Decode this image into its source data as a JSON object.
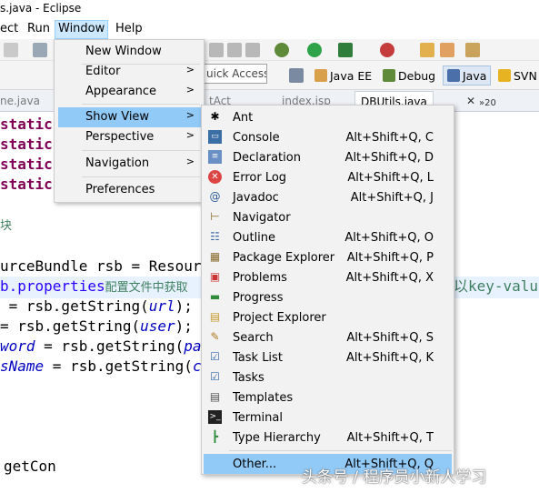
{
  "window": {
    "title": "s.java - Eclipse"
  },
  "menubar": {
    "items": [
      "ect",
      "Run",
      "Window",
      "Help"
    ]
  },
  "toolbar": {
    "quick_access": "uick Access",
    "perspectives": [
      "Java EE",
      "Debug",
      "Java",
      "SVN"
    ],
    "tab_number": "20"
  },
  "tabs": [
    "ne.java",
    "tAct",
    "index.jsp",
    "DBUtils.java"
  ],
  "window_menu": {
    "items": [
      "New Window",
      "Editor",
      "Appearance",
      "Show View",
      "Perspective",
      "Navigation",
      "Preferences"
    ]
  },
  "show_view": {
    "items": [
      {
        "label": "Ant",
        "shortcut": "",
        "icon": "ant-icon"
      },
      {
        "label": "Console",
        "shortcut": "Alt+Shift+Q, C",
        "icon": "console-icon"
      },
      {
        "label": "Declaration",
        "shortcut": "Alt+Shift+Q, D",
        "icon": "declaration-icon"
      },
      {
        "label": "Error Log",
        "shortcut": "Alt+Shift+Q, L",
        "icon": "error-log-icon"
      },
      {
        "label": "Javadoc",
        "shortcut": "Alt+Shift+Q, J",
        "icon": "javadoc-icon"
      },
      {
        "label": "Navigator",
        "shortcut": "",
        "icon": "navigator-icon"
      },
      {
        "label": "Outline",
        "shortcut": "Alt+Shift+Q, O",
        "icon": "outline-icon"
      },
      {
        "label": "Package Explorer",
        "shortcut": "Alt+Shift+Q, P",
        "icon": "package-explorer-icon"
      },
      {
        "label": "Problems",
        "shortcut": "Alt+Shift+Q, X",
        "icon": "problems-icon"
      },
      {
        "label": "Progress",
        "shortcut": "",
        "icon": "progress-icon"
      },
      {
        "label": "Project Explorer",
        "shortcut": "",
        "icon": "project-explorer-icon"
      },
      {
        "label": "Search",
        "shortcut": "Alt+Shift+Q, S",
        "icon": "search-icon"
      },
      {
        "label": "Task List",
        "shortcut": "Alt+Shift+Q, K",
        "icon": "task-list-icon"
      },
      {
        "label": "Tasks",
        "shortcut": "",
        "icon": "tasks-icon"
      },
      {
        "label": "Templates",
        "shortcut": "",
        "icon": "templates-icon"
      },
      {
        "label": "Terminal",
        "shortcut": "",
        "icon": "terminal-icon"
      },
      {
        "label": "Type Hierarchy",
        "shortcut": "Alt+Shift+Q, T",
        "icon": "type-hierarchy-icon"
      },
      {
        "label": "Other...",
        "shortcut": "Alt+Shift+Q, Q",
        "icon": ""
      }
    ]
  },
  "code": {
    "static_kw": "static",
    "block_comment": "块",
    "line_rsb_a": "urceBundle rsb = Resour",
    "line_rsb_b_field": "b.properties",
    "line_rsb_b_text": "配置文件中获取",
    "line_rsb_b_tail": "以key-valu",
    "line_url_a": " = rsb.getString(",
    "line_url_field": "url",
    "line_url_b": ");",
    "line_user_a": "= rsb.getString(",
    "line_user_field": "user",
    "line_user_b": ");",
    "line_pwd_field": "word",
    "line_pwd_a": " = rsb.getString(",
    "line_pwd_b": "pa",
    "line_cls_field": "sName",
    "line_cls_a": " = rsb.getString(",
    "line_cls_b": "c",
    "line_getcon": "getCon"
  },
  "watermark": "头条号 / 程序员小新人学习"
}
